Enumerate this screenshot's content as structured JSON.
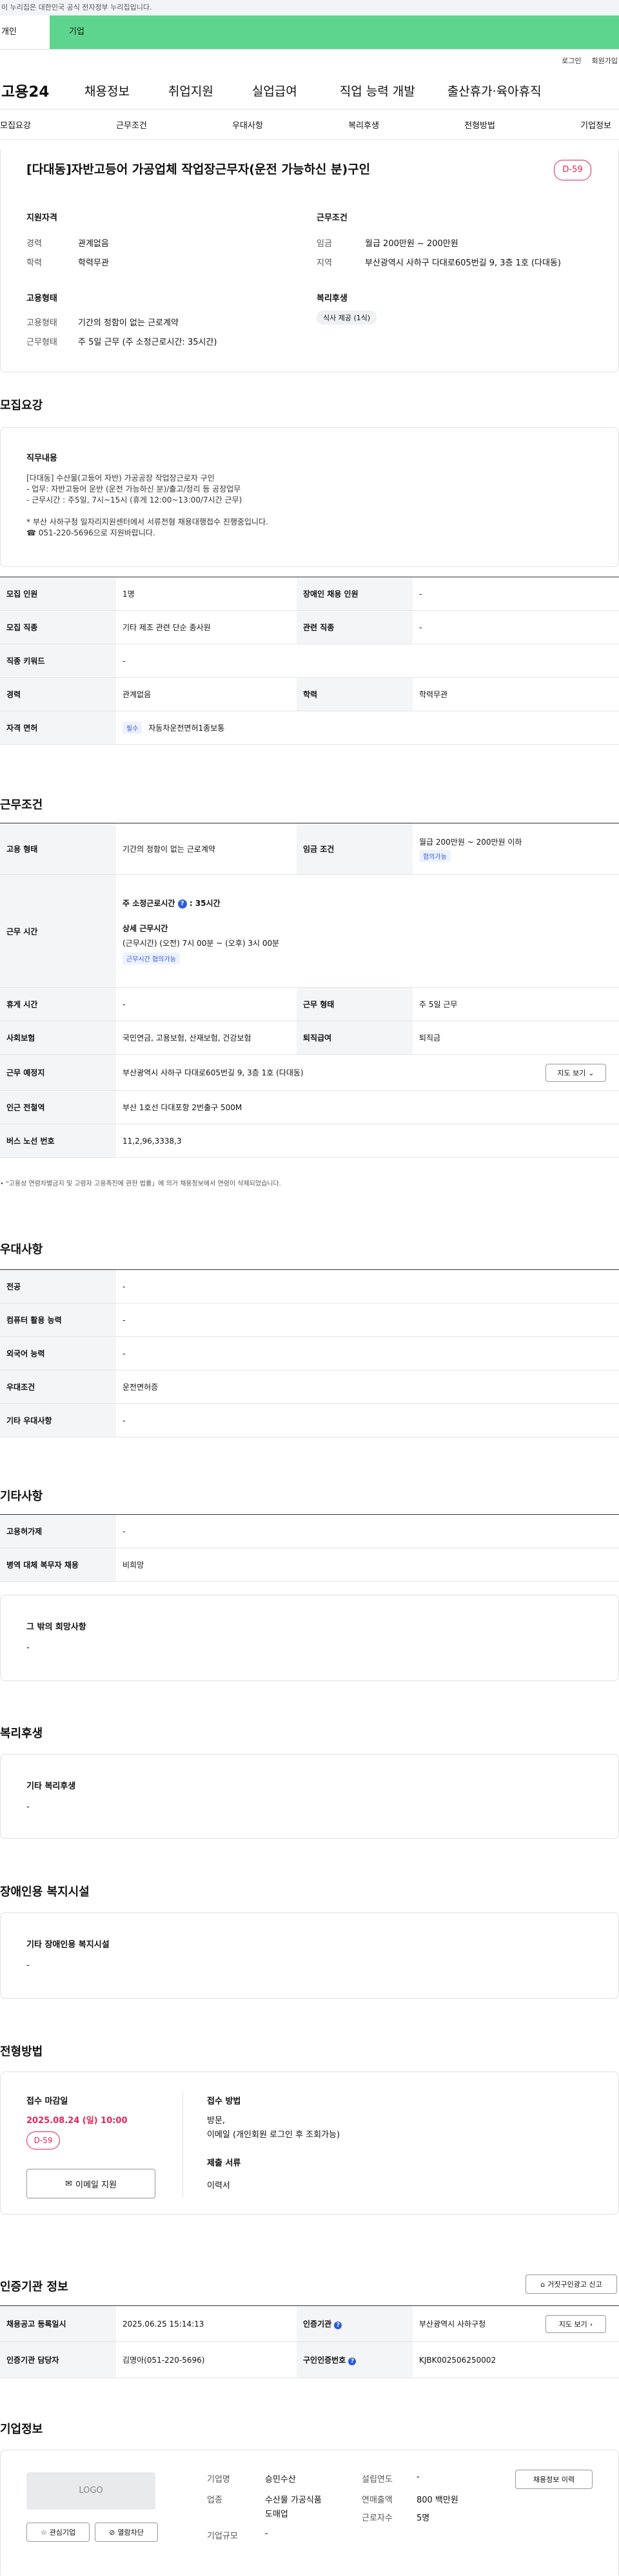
{
  "banner": {
    "text": "이 누리집은 대한민국 공식 전자정부 누리집입니다."
  },
  "tabs": {
    "personal": "개인",
    "business": "기업"
  },
  "util": {
    "login": "로그인",
    "join": "회원가입"
  },
  "gnb": {
    "logo": "고용24",
    "items": [
      "채용정보",
      "취업지원",
      "실업급여",
      "직업 능력 개발",
      "출산휴가·육아휴직"
    ]
  },
  "snb": {
    "items": [
      "모집요강",
      "근무조건",
      "우대사항",
      "복리후생",
      "전형방법",
      "기업정보"
    ]
  },
  "summary": {
    "title": "[다대동]자반고등어 가공업체 작업장근무자(운전 가능하신 분)구인",
    "dday": "D-59",
    "qual_head": "지원자격",
    "career_label": "경력",
    "career": "관계없음",
    "edu_label": "학력",
    "edu": "학력무관",
    "cond_head": "근무조건",
    "wage_label": "임금",
    "wage": "월급 200만원 ~ 200만원",
    "region_label": "지역",
    "region": "부산광역시 사하구 다대로605번길 9, 3층 1호 (다대동)",
    "emp_head": "고용형태",
    "emptype_label": "고용형태",
    "emptype": "기간의 정함이 없는 근로계약",
    "worktype_label": "근무형태",
    "worktype": "주 5일 근무 (주 소정근로시간: 35시간)",
    "welfare_head": "복리후생",
    "welfare_tag": "식사 제공 (1식)"
  },
  "recruit": {
    "section_title": "모집요강",
    "job_head": "직무내용",
    "job_lines": [
      "[다대동] 수산물(고등어 자반) 가공공장 작업장근로자 구인",
      "- 업무: 자반고등어 운반 (운전 가능하신 분)/출고/정리 등 공장업무",
      "- 근무시간 : 주5일, 7시~15시 (휴게 12:00~13:00/7시간 근무)",
      "",
      "* 부산 사하구청 일자리지원센터에서 서류전형 채용대행접수 진행중입니다.",
      "☎ 051-220-5696으로 지원바랍니다."
    ],
    "rows": [
      {
        "k1": "모집 인원",
        "v1": "1명",
        "k2": "장애인 채용 인원",
        "v2": "-"
      },
      {
        "k1": "모집 직종",
        "v1": "기타 제조 관련 단순 종사원",
        "k2": "관련 직종",
        "v2": "-"
      },
      {
        "k1": "직종 키워드",
        "v1": "-",
        "k2": "",
        "v2": ""
      },
      {
        "k1": "경력",
        "v1": "관계없음",
        "k2": "학력",
        "v2": "학력무관"
      }
    ],
    "license_label": "자격 면허",
    "license_tag": "필수",
    "license_value": "자동차운전면허1종보통"
  },
  "work": {
    "section_title": "근무조건",
    "emp_label": "고용 형태",
    "emp": "기간의 정함이 없는 근로계약",
    "wage_label": "임금 조건",
    "wage": "월급 200만원 ~ 200만원 이하",
    "wage_tag": "협의가능",
    "hours_label": "근무 시간",
    "hours_week_label": "주 소정근로시간",
    "hours_week": ": 35시간",
    "detail_head": "상세 근무시간",
    "detail_text": "(근무시간) (오전) 7시 00분 ~ (오후) 3시 00분",
    "detail_tag": "근무시간 협의가능",
    "break_label": "휴게 시간",
    "break": "-",
    "shift_label": "근무 형태",
    "shift": "주 5일 근무",
    "ins_label": "사회보험",
    "ins": "국민연금, 고용보험, 산재보험, 건강보험",
    "sev_label": "퇴직급여",
    "sev": "퇴직금",
    "place_label": "근무 예정지",
    "place": "부산광역시 사하구 다대로605번길 9, 3층 1호 (다대동)",
    "map_btn": "지도 보기",
    "subway_label": "인근 전철역",
    "subway": "부산 1호선 다대포항 2번출구 500M",
    "bus_label": "버스 노선 번호",
    "bus": "11,2,96,3338,3",
    "note": "\"고용상 연령차별금지 및 고령자 고용촉진에 관한 법률」에 의거 채용정보에서 연령이 삭제되었습니다."
  },
  "pref": {
    "section_title": "우대사항",
    "rows": [
      {
        "k": "전공",
        "v": "-"
      },
      {
        "k": "컴퓨터 활용 능력",
        "v": "-"
      },
      {
        "k": "외국어 능력",
        "v": "-"
      },
      {
        "k": "우대조건",
        "v": "운전면허증"
      },
      {
        "k": "기타 우대사항",
        "v": "-"
      }
    ]
  },
  "etc": {
    "section_title": "기타사항",
    "rows": [
      {
        "k": "고용허가제",
        "v": "-"
      },
      {
        "k": "병역 대체 복무자 채용",
        "v": "비희망"
      }
    ],
    "other_head": "그 밖의 희망사항",
    "other": "-"
  },
  "welfare": {
    "section_title": "복리후생",
    "head": "기타 복리후생",
    "value": "-"
  },
  "disabled": {
    "section_title": "장애인용 복지시설",
    "head": "기타 장애인용 복지시설",
    "value": "-"
  },
  "process": {
    "section_title": "전형방법",
    "deadline_head": "접수 마감일",
    "deadline": "2025.08.24 (일) 10:00",
    "dday": "D-59",
    "email_btn": "이메일 지원",
    "method_head": "접수 방법",
    "method1": "방문,",
    "method2": "이메일 (개인회원 로그인 후 조회가능)",
    "docs_head": "제출 서류",
    "docs": "이력서"
  },
  "cert": {
    "section_title": "인증기관 정보",
    "report_btn": "거짓구인광고 신고",
    "reg_label": "채용공고 등록일시",
    "reg": "2025.06.25 15:14:13",
    "org_label": "인증기관",
    "org": "부산광역시 사하구청",
    "map_btn": "지도 보기",
    "manager_label": "인증기관 담당자",
    "manager": "김명아(051-220-5696)",
    "num_label": "구인인증번호",
    "num": "KJBK002506250002"
  },
  "company": {
    "section_title": "기업정보",
    "logo": "LOGO",
    "fav_btn": "관심기업",
    "block_btn": "열람차단",
    "name_label": "기업명",
    "name": "승민수산",
    "biz_label": "업종",
    "biz1": "수산물 가공식품",
    "biz2": "도매업",
    "size_label": "기업규모",
    "size": "-",
    "year_label": "설립연도",
    "year": "-",
    "sales_label": "연매출액",
    "sales": "800 백만원",
    "emp_label": "근로자수",
    "emp": "5명",
    "history_btn": "채용정보 이력"
  }
}
